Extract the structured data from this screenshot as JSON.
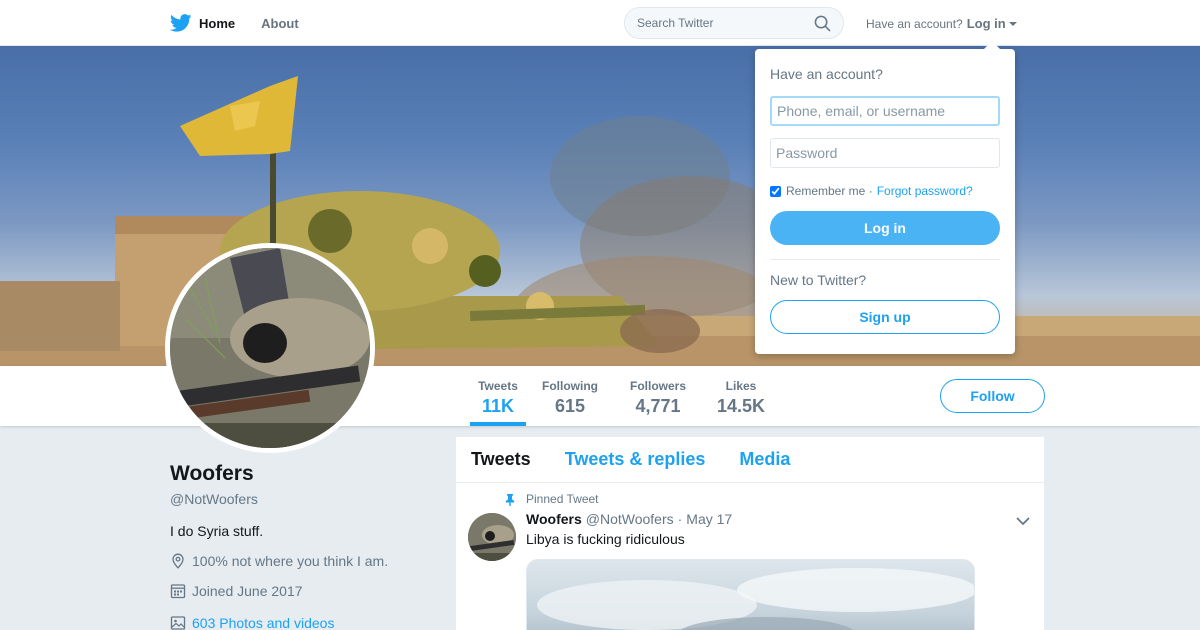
{
  "nav": {
    "home_label": "Home",
    "about_label": "About",
    "search_placeholder": "Search Twitter",
    "have_account": "Have an account?",
    "login_label": "Log in"
  },
  "profile_nav": {
    "stats": [
      {
        "label": "Tweets",
        "value": "11K"
      },
      {
        "label": "Following",
        "value": "615"
      },
      {
        "label": "Followers",
        "value": "4,771"
      },
      {
        "label": "Likes",
        "value": "14.5K"
      }
    ],
    "follow_label": "Follow"
  },
  "profile": {
    "name": "Woofers",
    "handle": "@NotWoofers",
    "bio": "I do Syria stuff.",
    "location": "100% not where you think I am.",
    "joined": "Joined June 2017",
    "media_link": "603 Photos and videos"
  },
  "timeline": {
    "tabs": [
      "Tweets",
      "Tweets & replies",
      "Media"
    ],
    "tweet": {
      "pinned_label": "Pinned Tweet",
      "name": "Woofers",
      "handle": "@NotWoofers",
      "separator": "·",
      "date": "May 17",
      "text": "Libya is fucking ridiculous"
    }
  },
  "login_dropdown": {
    "title": "Have an account?",
    "username_placeholder": "Phone, email, or username",
    "password_placeholder": "Password",
    "remember_label": "Remember me ·",
    "forgot_label": "Forgot password?",
    "login_button": "Log in",
    "new_label": "New to Twitter?",
    "signup_button": "Sign up"
  },
  "colors": {
    "accent": "#1da1f2",
    "background": "#e6ecf0"
  }
}
